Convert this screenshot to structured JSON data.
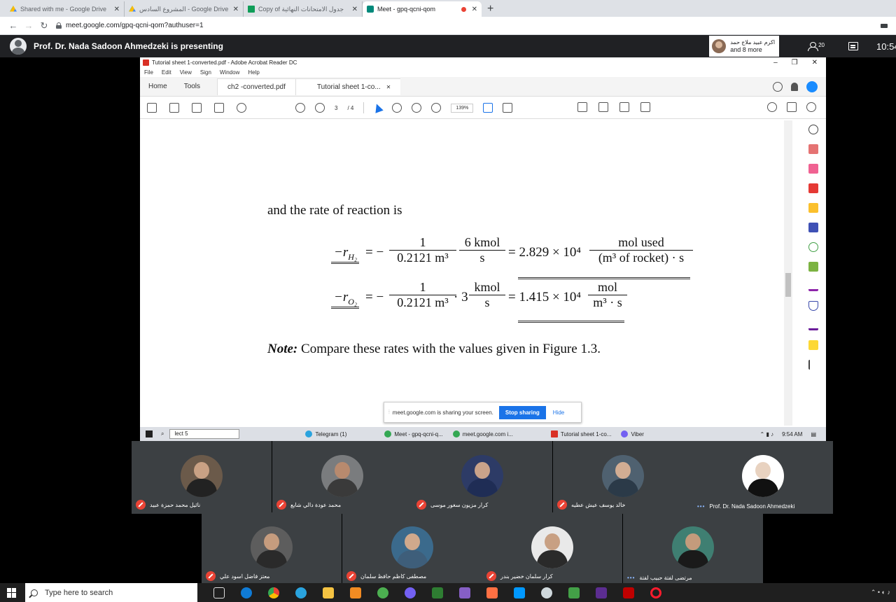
{
  "browser": {
    "tabs": [
      {
        "title": "Shared with me - Google Drive",
        "icon": "google-drive-icon",
        "active": false
      },
      {
        "title": "المشروع السادس - Google Drive",
        "icon": "google-drive-icon",
        "active": false
      },
      {
        "title": "Copy of جدول الامتحانات النهائية",
        "icon": "google-sheets-icon",
        "active": false
      },
      {
        "title": "Meet - gpq-qcni-qom",
        "icon": "google-meet-icon",
        "active": true,
        "recording": true
      }
    ],
    "url": "meet.google.com/gpq-qcni-qom?authuser=1"
  },
  "meet": {
    "presenting_text": "Prof. Dr. Nada Sadoon Ahmedzeki is presenting",
    "others_name": "اكرم عبيد ملاج حمد",
    "others_more": "and 8 more",
    "participant_count": "20",
    "time": "10:54"
  },
  "acrobat": {
    "window_title": "Tutorial sheet 1-converted.pdf - Adobe Acrobat Reader DC",
    "menu": [
      "File",
      "Edit",
      "View",
      "Sign",
      "Window",
      "Help"
    ],
    "tabs": [
      "Home",
      "Tools",
      "ch2 -converted.pdf",
      "Tutorial sheet 1-co..."
    ],
    "page_current": "3",
    "page_total": "/ 4",
    "zoom": "139%"
  },
  "document": {
    "line1": "and the rate of reaction is",
    "eq1_lhs": "−r",
    "eq1_sub": "H₂",
    "eq1_f1_num": "1",
    "eq1_f1_den": "0.2121 m³",
    "eq1_f2_num": "6 kmol",
    "eq1_f2_den": "s",
    "eq1_result": "= 2.829 × 10⁴",
    "eq1_f3_num": "mol used",
    "eq1_f3_den": "(m³ of rocket) · s",
    "eq2_lhs": "−r",
    "eq2_sub": "O₂",
    "eq2_f1_num": "1",
    "eq2_f1_den": "0.2121 m³",
    "eq2_mult": "· 3",
    "eq2_f2_num": "kmol",
    "eq2_f2_den": "s",
    "eq2_result": "= 1.415 × 10⁴",
    "eq2_f3_num": "mol",
    "eq2_f3_den": "m³ · s",
    "note_label": "Note:",
    "note_text": "Compare these rates with the values given in Figure 1.3."
  },
  "share_notice": {
    "text": "meet.google.com is sharing your screen.",
    "stop": "Stop sharing",
    "hide": "Hide"
  },
  "inner_taskbar": {
    "search": "lect 5",
    "items": [
      "Telegram (1)",
      "Meet - gpq-qcni-q...",
      "meet.google.com i...",
      "Tutorial sheet 1-co...",
      "Viber"
    ],
    "time": "9:54 AM"
  },
  "participants": [
    {
      "name": "نائيل محمد حمزة عبيد",
      "muted": true,
      "avatar_bg": "#6b5a4a",
      "skin": "#c9a184",
      "shirt": "#222222"
    },
    {
      "name": "محمد عودة دالي شايع",
      "muted": true,
      "avatar_bg": "#7a7c7e",
      "skin": "#b88a6e",
      "shirt": "#3a3a3a"
    },
    {
      "name": "كرار مزيون سغور موسى",
      "muted": true,
      "avatar_bg": "#2d3b66",
      "skin": "#caa38a",
      "shirt": "#1f2d55"
    },
    {
      "name": "خالد يوسف عيش عطيه",
      "muted": true,
      "avatar_bg": "#4f6170",
      "skin": "#d2ad93",
      "shirt": "#2b3a48"
    },
    {
      "name": "Prof. Dr. Nada Sadoon Ahmedzeki",
      "muted": false,
      "avatar_bg": "#ffffff",
      "skin": "#e8d2c0",
      "shirt": "#111111"
    },
    {
      "name": "معتز فاضل اسود علي",
      "muted": true,
      "avatar_bg": "#5d5d5d",
      "skin": "#c69c7e",
      "shirt": "#2a2a2a"
    },
    {
      "name": "مصطفى كاظم حافظ سلمان",
      "muted": true,
      "avatar_bg": "#3b6a8c",
      "skin": "#d0a98c",
      "shirt": "#3e5e7a"
    },
    {
      "name": "كرار سلمان خضير بندر",
      "muted": true,
      "avatar_bg": "#e9e9e9",
      "skin": "#c8a083",
      "shirt": "#2a2a2a"
    },
    {
      "name": "مرتضى لفتة حبيب لفتة",
      "muted": false,
      "avatar_bg": "#3f7f72",
      "skin": "#c49b7c",
      "shirt": "#1a1a1a"
    }
  ],
  "taskbar": {
    "search_placeholder": "Type here to search"
  }
}
